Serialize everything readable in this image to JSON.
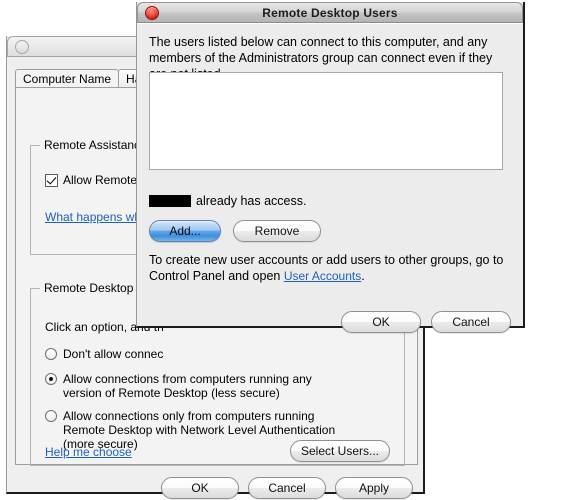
{
  "background_window": {
    "title": "",
    "close_icon": "close-button-inactive",
    "tabs": [
      {
        "label": "Computer Name",
        "selected": true
      },
      {
        "label": "Hardw",
        "selected": false
      }
    ],
    "remote_assistance": {
      "group_title": "Remote Assistance",
      "checkbox_label": "Allow Remote Assis",
      "checkbox_checked": true,
      "link_label": "What happens when I"
    },
    "remote_desktop": {
      "group_title": "Remote Desktop",
      "instruction": "Click an option, and th",
      "options": [
        {
          "label": "Don't allow connec",
          "selected": false
        },
        {
          "label": "Allow connections from computers running any version of Remote Desktop (less secure)",
          "selected": true
        },
        {
          "label": "Allow connections only from computers running Remote Desktop with Network Level Authentication (more secure)",
          "selected": false
        }
      ],
      "help_link": "Help me choose",
      "select_users_button": "Select Users..."
    },
    "footer": {
      "ok": "OK",
      "cancel": "Cancel",
      "apply": "Apply"
    }
  },
  "dialog": {
    "title": "Remote Desktop Users",
    "close_icon": "close-button-active",
    "description": "The users listed below can connect to this computer, and any members of the Administrators group can connect even if they are not listed.",
    "user_list_items": [],
    "access_note": {
      "redacted_user": "",
      "text": "already has access."
    },
    "add_button": "Add...",
    "remove_button": "Remove",
    "create_note_prefix": "To create new user accounts or add users to other groups, go to Control Panel and open ",
    "create_note_link": "User Accounts",
    "create_note_suffix": ".",
    "ok": "OK",
    "cancel": "Cancel"
  },
  "colors": {
    "link": "#1d5fbd",
    "default_button": "#5ea5e8",
    "window_bg": "#efefef",
    "dialog_bg": "#ececec",
    "redaction": "#000000"
  }
}
